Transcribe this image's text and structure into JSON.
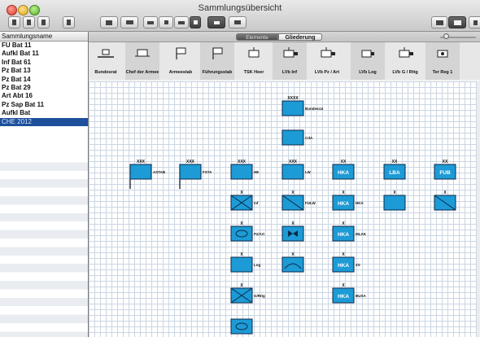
{
  "window": {
    "title": "Sammlungsübersicht"
  },
  "sidebar": {
    "header": "Sammlungsname",
    "items": [
      {
        "label": "FU Bat 11"
      },
      {
        "label": "Aufkl Bat 11"
      },
      {
        "label": "Inf Bat 61"
      },
      {
        "label": "Pz Bat 13"
      },
      {
        "label": "Pz Bat 14"
      },
      {
        "label": "Pz Bat 29"
      },
      {
        "label": "Art Abt 16"
      },
      {
        "label": "Pz Sap Bat 11"
      },
      {
        "label": "Aufkl Bat"
      },
      {
        "label": "CHE 2012",
        "selected": true
      }
    ]
  },
  "tabs": {
    "left": "Elemente",
    "right": "Gliederung"
  },
  "palette": [
    {
      "label": "Bundesrat",
      "icon": "table-flag-icon"
    },
    {
      "label": "Chef der Armee",
      "icon": "flag-box-icon"
    },
    {
      "label": "Armeestab",
      "icon": "staff-flag-icon"
    },
    {
      "label": "Führungsstab",
      "icon": "staff-flag-icon"
    },
    {
      "label": "TSK Heer",
      "icon": "unit-box-icon"
    },
    {
      "label": "LVb Inf",
      "icon": "unit-cross-icon"
    },
    {
      "label": "LVb Pz / Art",
      "icon": "unit-cross-icon"
    },
    {
      "label": "LVb Log",
      "icon": "unit-plug-icon"
    },
    {
      "label": "LVb G / Rttg",
      "icon": "unit-cross-icon"
    },
    {
      "label": "Ter Reg 1",
      "icon": "unit-dot-icon"
    }
  ],
  "diagram": {
    "top": {
      "label": "Bundesrat",
      "echelon": "XXXX"
    },
    "cda": {
      "label": "CdA",
      "echelon": ""
    },
    "row1": [
      {
        "label": "ASTAB",
        "echelon": "XXX",
        "flag": true
      },
      {
        "label": "FSTA",
        "echelon": "XXX",
        "flag": true
      },
      {
        "label": "HE",
        "echelon": "XXX"
      },
      {
        "label": "LW",
        "echelon": "XXX"
      },
      {
        "text": "HKA",
        "echelon": "XX"
      },
      {
        "text": "LBA",
        "echelon": "XX"
      },
      {
        "text": "FUB",
        "echelon": "XX"
      }
    ],
    "col_he": [
      {
        "label": "Inf",
        "echelon": "X"
      },
      {
        "label": "Pz/Art",
        "echelon": "X"
      },
      {
        "label": "Log",
        "echelon": "X"
      },
      {
        "label": "G/Rttg",
        "echelon": "X"
      }
    ],
    "col_lw": [
      {
        "label": "FULW",
        "echelon": "X"
      },
      {
        "label": "",
        "echelon": "X"
      },
      {
        "label": "",
        "echelon": "X"
      }
    ],
    "col_hka": [
      {
        "text": "HKA",
        "label": "HKA",
        "echelon": "X"
      },
      {
        "text": "HKA",
        "label": "MLAK",
        "echelon": "X"
      },
      {
        "text": "HKA",
        "label": "ZS",
        "echelon": "X"
      },
      {
        "text": "HKA",
        "label": "BUSA",
        "echelon": "X"
      }
    ],
    "extra": [
      {
        "label": "",
        "echelon": "X"
      },
      {
        "label": "",
        "echelon": "X"
      }
    ]
  },
  "colors": {
    "unit_fill": "#1c9bd6",
    "selection": "#1d4f9c"
  }
}
